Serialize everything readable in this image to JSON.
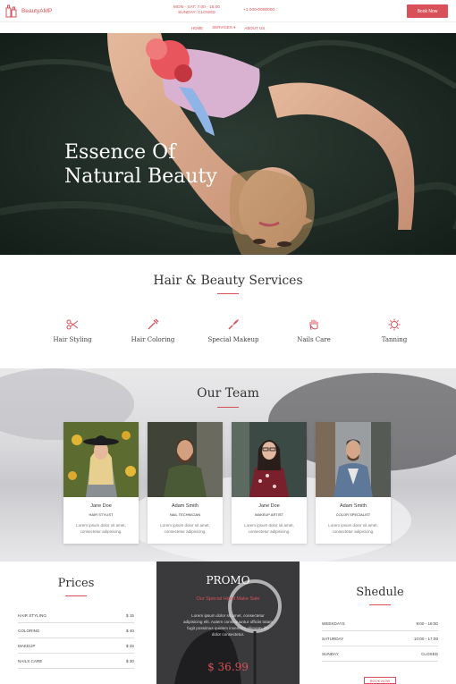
{
  "header": {
    "brand": "BeautyAMP",
    "hours_line1": "MON - SAT: 7.00 - 18.00",
    "hours_line2": "SUNDAY: CLOSED",
    "phone": "+1 000-0000000",
    "book_label": "Book Now"
  },
  "nav": {
    "items": [
      "HOME",
      "SERVICES ▾",
      "ABOUT US"
    ]
  },
  "hero": {
    "title_line1": "Essence Of",
    "title_line2": "Natural Beauty"
  },
  "services": {
    "title": "Hair & Beauty Services",
    "items": [
      {
        "label": "Hair Styling",
        "icon": "scissors-icon"
      },
      {
        "label": "Hair Coloring",
        "icon": "dropper-icon"
      },
      {
        "label": "Special Makeup",
        "icon": "brush-icon"
      },
      {
        "label": "Nails Care",
        "icon": "hand-icon"
      },
      {
        "label": "Tanning",
        "icon": "sun-icon"
      }
    ]
  },
  "team": {
    "title": "Our Team",
    "members": [
      {
        "name": "Jane Doe",
        "role": "HAIR STYLIST",
        "desc": "Lorem ipsum dolor sit amet, consectetur adipisicing."
      },
      {
        "name": "Adam Smith",
        "role": "NAIL TECHNICIAN",
        "desc": "Lorem ipsum dolor sit amet, consectetur adipisicing."
      },
      {
        "name": "Jane Doe",
        "role": "MAKEUP ARTIST",
        "desc": "Lorem ipsum dolor sit amet, consectetur adipisicing."
      },
      {
        "name": "Adam Smith",
        "role": "COLOR SPECIALIST",
        "desc": "Lorem ipsum dolor sit amet, consectetur adipisicing."
      }
    ]
  },
  "prices": {
    "title": "Prices",
    "rows": [
      {
        "name": "HAIR STYLING",
        "price": "$ 15"
      },
      {
        "name": "COLORING",
        "price": "$ 40"
      },
      {
        "name": "MAKEUP",
        "price": "$ 25"
      },
      {
        "name": "NAILS CARE",
        "price": "$ 30"
      }
    ]
  },
  "promo": {
    "title": "PROMO",
    "subtitle": "Our Special Hand Make Sale",
    "text": "Lorem ipsum dolor sit amet, consectetur adipisicing elit. Autem consequuntur officiis totam fugit possimus quidem inventore aliquam, illo dolor consectetur.",
    "price": "$ 36.99"
  },
  "schedule": {
    "title": "Shedule",
    "rows": [
      {
        "day": "WEEKDAYS",
        "time": "9:00 - 18:00"
      },
      {
        "day": "SATURDAY",
        "time": "10:00 - 17:00"
      },
      {
        "day": "SUNDAY",
        "time": "CLOSED"
      }
    ],
    "button": "BOOK NOW"
  },
  "colors": {
    "accent": "#d8505a"
  }
}
